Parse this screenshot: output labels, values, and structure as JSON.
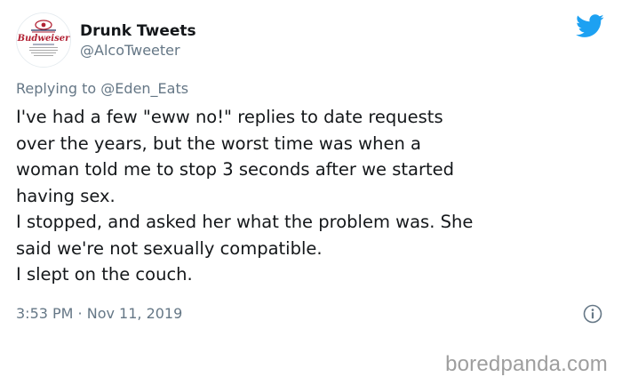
{
  "tweet": {
    "display_name": "Drunk Tweets",
    "handle": "@AlcoTweeter",
    "replying_prefix": "Replying to",
    "replying_to": "@Eden_Eats",
    "text": "I've had a few \"eww no!\" replies to date requests\nover the years, but the worst time was when a\nwoman told me to stop 3 seconds after we started\nhaving sex.\nI stopped, and asked her what the problem was. She\nsaid we're not sexually compatible.\nI slept on the couch.",
    "timestamp": "3:53 PM · Nov 11, 2019"
  },
  "avatar": {
    "brand_text": "Budweiser"
  },
  "icons": {
    "twitter_logo": "twitter-bird-icon",
    "info": "info-icon"
  },
  "colors": {
    "twitter_blue": "#1da1f2",
    "secondary_text": "#657786",
    "primary_text": "#14171a",
    "watermark": "#9e9e9e"
  },
  "watermark": {
    "text": "boredpanda.com"
  }
}
